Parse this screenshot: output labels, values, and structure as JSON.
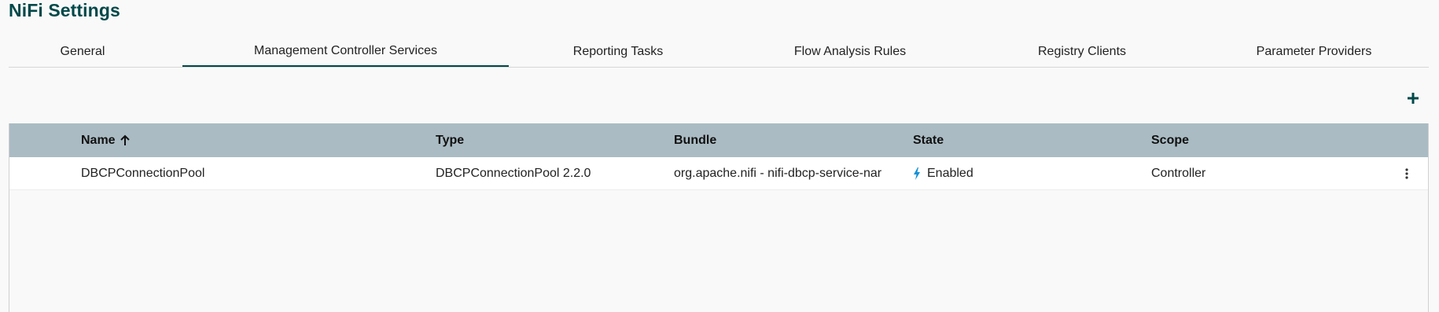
{
  "page": {
    "title": "NiFi Settings"
  },
  "tabs": [
    {
      "label": "General"
    },
    {
      "label": "Management Controller Services",
      "active": true
    },
    {
      "label": "Reporting Tasks"
    },
    {
      "label": "Flow Analysis Rules"
    },
    {
      "label": "Registry Clients"
    },
    {
      "label": "Parameter Providers"
    }
  ],
  "toolbar": {
    "add_icon": "plus-icon"
  },
  "table": {
    "columns": {
      "name": "Name",
      "name_sort_icon": "arrow-up-icon",
      "type": "Type",
      "bundle": "Bundle",
      "state": "State",
      "scope": "Scope"
    },
    "rows": [
      {
        "name": "DBCPConnectionPool",
        "type": "DBCPConnectionPool 2.2.0",
        "bundle": "org.apache.nifi - nifi-dbcp-service-nar",
        "state": "Enabled",
        "state_icon": "lightning-bolt-icon",
        "scope": "Controller",
        "actions_icon": "more-vertical-icon"
      }
    ]
  },
  "colors": {
    "title": "#004849",
    "active_tab_underline": "#004849",
    "header_bg": "#aabbc3",
    "enabled_bolt": "#1491d6"
  }
}
